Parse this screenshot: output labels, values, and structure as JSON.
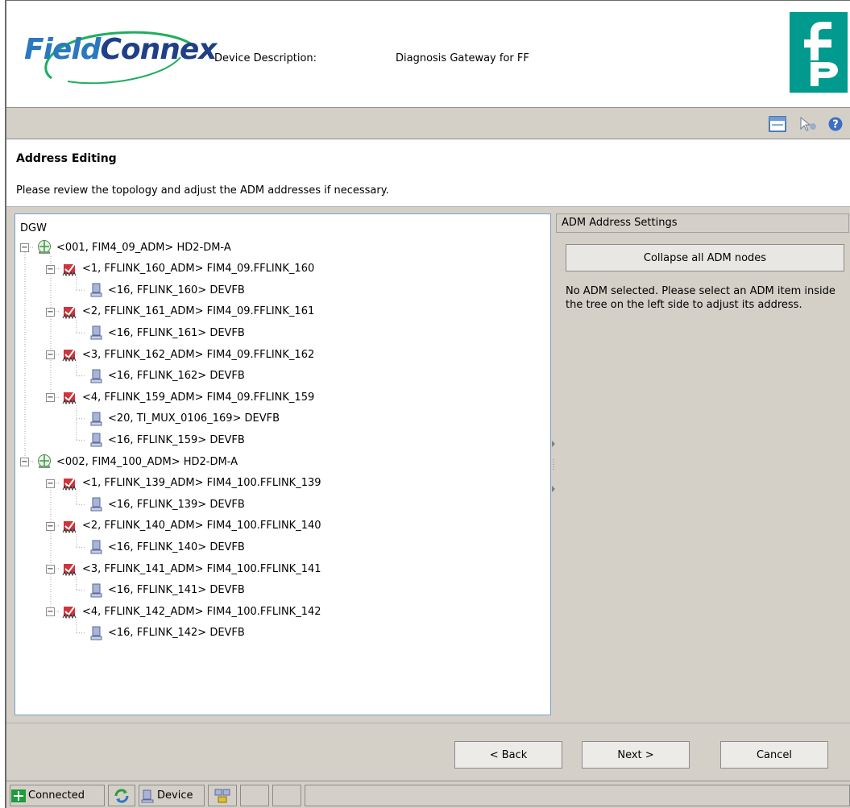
{
  "header": {
    "logo_field": "Field",
    "logo_connex": "Connex",
    "device_label": "Device Description:",
    "device_value": "Diagnosis Gateway for FF"
  },
  "toolbar": {
    "icons": [
      "window-icon",
      "pointer-help-icon",
      "help-icon"
    ]
  },
  "page": {
    "title": "Address Editing",
    "description": "Please review the topology and adjust the ADM addresses if necessary."
  },
  "tree": {
    "root": "DGW",
    "nodes": [
      {
        "level": 1,
        "icon": "gateway-icon",
        "label": "<001, FIM4_09_ADM> HD2-DM-A"
      },
      {
        "level": 2,
        "icon": "adm-icon",
        "label": "<1, FFLINK_160_ADM> FIM4_09.FFLINK_160"
      },
      {
        "level": 3,
        "icon": "device-icon",
        "label": "<16, FFLINK_160> DEVFB"
      },
      {
        "level": 2,
        "icon": "adm-icon",
        "label": "<2, FFLINK_161_ADM> FIM4_09.FFLINK_161"
      },
      {
        "level": 3,
        "icon": "device-icon",
        "label": "<16, FFLINK_161> DEVFB"
      },
      {
        "level": 2,
        "icon": "adm-icon",
        "label": "<3, FFLINK_162_ADM> FIM4_09.FFLINK_162"
      },
      {
        "level": 3,
        "icon": "device-icon",
        "label": "<16, FFLINK_162> DEVFB"
      },
      {
        "level": 2,
        "icon": "adm-icon",
        "label": "<4, FFLINK_159_ADM> FIM4_09.FFLINK_159"
      },
      {
        "level": 3,
        "icon": "device-icon",
        "label": "<20, TI_MUX_0106_169> DEVFB"
      },
      {
        "level": 3,
        "icon": "device-icon",
        "label": "<16, FFLINK_159> DEVFB"
      },
      {
        "level": 1,
        "icon": "gateway-icon",
        "label": "<002, FIM4_100_ADM> HD2-DM-A"
      },
      {
        "level": 2,
        "icon": "adm-icon",
        "label": "<1, FFLINK_139_ADM> FIM4_100.FFLINK_139"
      },
      {
        "level": 3,
        "icon": "device-icon",
        "label": "<16, FFLINK_139> DEVFB"
      },
      {
        "level": 2,
        "icon": "adm-icon",
        "label": "<2, FFLINK_140_ADM> FIM4_100.FFLINK_140"
      },
      {
        "level": 3,
        "icon": "device-icon",
        "label": "<16, FFLINK_140> DEVFB"
      },
      {
        "level": 2,
        "icon": "adm-icon",
        "label": "<3, FFLINK_141_ADM> FIM4_100.FFLINK_141"
      },
      {
        "level": 3,
        "icon": "device-icon",
        "label": "<16, FFLINK_141> DEVFB"
      },
      {
        "level": 2,
        "icon": "adm-icon",
        "label": "<4, FFLINK_142_ADM> FIM4_100.FFLINK_142"
      },
      {
        "level": 3,
        "icon": "device-icon",
        "label": "<16, FFLINK_142> DEVFB"
      }
    ]
  },
  "right_panel": {
    "header": "ADM Address Settings",
    "collapse_button": "Collapse all ADM nodes",
    "message": "No ADM selected. Please select an ADM item inside the tree on the left side to adjust its address."
  },
  "buttons": {
    "back": "< Back",
    "next": "Next >",
    "cancel": "Cancel"
  },
  "statusbar": {
    "connected": "Connected",
    "device": "Device"
  },
  "colors": {
    "pf_green": "#009a8e",
    "panel_gray": "#d4d0c8",
    "logo_blue": "#2a78c0",
    "logo_navy": "#1f3f86"
  }
}
